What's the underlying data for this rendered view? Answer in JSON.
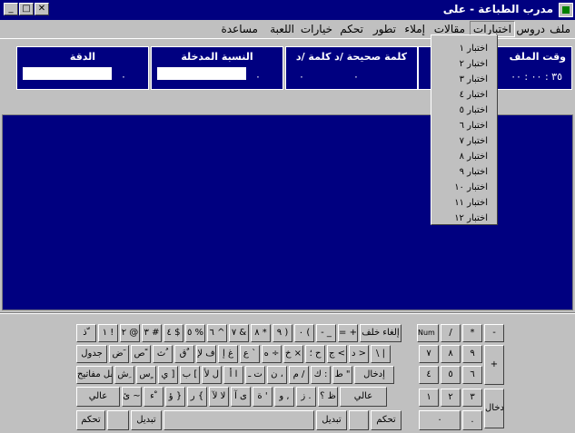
{
  "window": {
    "title": "مدرب الطباعة - على",
    "min": "_",
    "max": "□",
    "close": "✕"
  },
  "menu": [
    {
      "label": "ملف",
      "r": 2
    },
    {
      "label": "دروس",
      "r": 30
    },
    {
      "label": "اختبارات",
      "r": 66,
      "active": true
    },
    {
      "label": "مقالات",
      "r": 118
    },
    {
      "label": "إملاء",
      "r": 162
    },
    {
      "label": "تطور",
      "r": 194
    },
    {
      "label": "تحكم",
      "r": 230
    },
    {
      "label": "خيارات",
      "r": 264
    },
    {
      "label": "اللعبة",
      "r": 306
    },
    {
      "label": "مساعدة",
      "r": 346
    }
  ],
  "stats": {
    "file_time": {
      "label": "وقت الملف",
      "value": "٣٥ : ٠٠ : ٠٠"
    },
    "words_per_min": {
      "label": "كلمة صحيحة /د   كلمة /د",
      "value1": "٠",
      "value2": "٠"
    },
    "input_ratio": {
      "label": "النسبة المدخلة",
      "value": "٠"
    },
    "accuracy": {
      "label": "الدقة",
      "value": "٠"
    }
  },
  "dropdown": {
    "items": [
      "اختبار ١",
      "اختبار ٢",
      "اختبار ٣",
      "اختبار ٤",
      "اختبار ٥",
      "اختبار ٦",
      "اختبار ٧",
      "اختبار ٨",
      "اختبار ٩",
      "اختبار ١٠",
      "اختبار ١١",
      "اختبار ١٢"
    ]
  },
  "keyboard": {
    "row1": [
      "ذ ّ",
      "١ !",
      "٢ @",
      "٣ #",
      "٤ $",
      "٥ %",
      "٦ ^",
      "٧ &",
      "٨ *",
      "٩ )",
      "٠ (",
      "- _",
      "= +",
      "إلغاء خلف"
    ],
    "row2": [
      "جدول",
      "ض َ",
      "ص ً",
      "ث ُ",
      "ق ٌ",
      "ف ﻹ",
      "غ إ",
      "ع `",
      "ه ÷",
      "خ ×",
      "ح ؛",
      "ج <",
      "د >",
      "\\ |"
    ],
    "row3": [
      "قفل مفاتيح",
      "ش ِ",
      "س ٍ",
      "ي ]",
      "ب [",
      "ل ﻷ",
      "ا أ",
      "ت ـ",
      "ن ،",
      "م /",
      "ك :",
      "ط \"",
      "إدخال"
    ],
    "row4": [
      "عالي",
      "ئ ~",
      "ء ْ",
      "ؤ }",
      "ر {",
      "ﻻ ﻵ",
      "ى آ",
      "ة '",
      "و ,",
      "ز .",
      "ظ ؟",
      "عالي"
    ],
    "row5": [
      "تحكم",
      "",
      "تبديل",
      "",
      "تبديل",
      "",
      "تحكم"
    ],
    "numpad": {
      "numlock": "Num Lock",
      "div": "/",
      "mul": "*",
      "sub": "-",
      "r2": [
        "٧",
        "٨",
        "٩"
      ],
      "add": "+",
      "r3": [
        "٤",
        "٥",
        "٦"
      ],
      "r4": [
        "١",
        "٢",
        "٣"
      ],
      "enter": "إدخال",
      "zero": "٠",
      "dot": "."
    }
  }
}
